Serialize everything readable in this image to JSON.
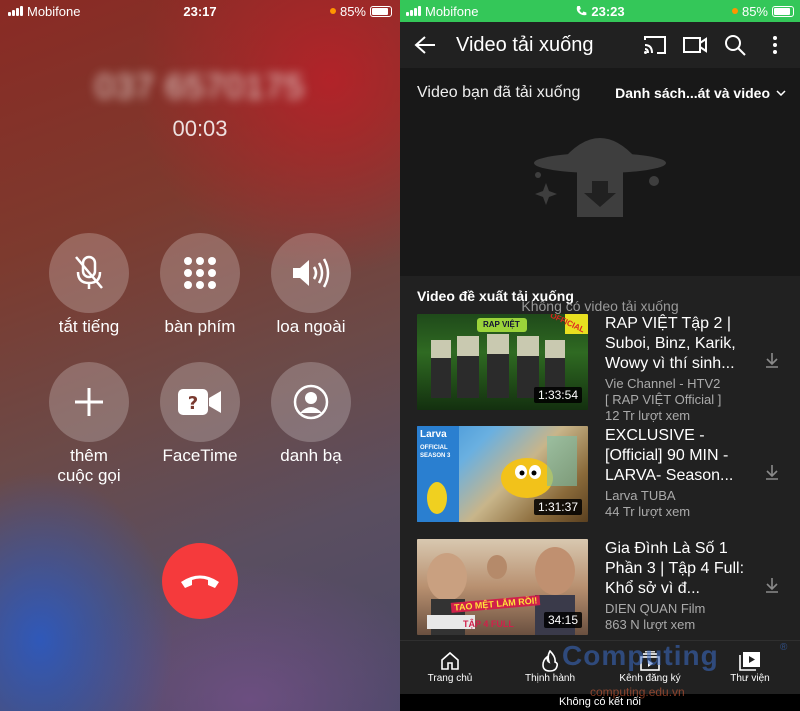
{
  "call_screen": {
    "status_bar": {
      "carrier": "Mobifone",
      "time": "23:17",
      "battery": "85%"
    },
    "caller_number": "037 6570175",
    "call_duration": "00:03",
    "controls": [
      {
        "label": "tắt tiếng",
        "icon": "mic-off-icon"
      },
      {
        "label": "bàn phím",
        "icon": "keypad-icon"
      },
      {
        "label": "loa ngoài",
        "icon": "speaker-icon"
      },
      {
        "label": "thêm\ncuộc gọi",
        "icon": "plus-icon"
      },
      {
        "label": "FaceTime",
        "icon": "facetime-icon"
      },
      {
        "label": "danh bạ",
        "icon": "contacts-icon"
      }
    ],
    "end_call_color": "#f53a3c"
  },
  "youtube": {
    "status_bar": {
      "carrier": "Mobifone",
      "time": "23:23",
      "battery": "85%",
      "bar_color": "#34c759"
    },
    "app_bar": {
      "title": "Video tải xuống"
    },
    "downloads": {
      "label": "Video bạn đã tải xuống",
      "sort": "Danh sách...át và video",
      "empty_text": "Không có video tải xuống"
    },
    "suggestions_title": "Video đề xuất tải xuống",
    "videos": [
      {
        "title": "RAP VIỆT Tập 2 | Suboi, Binz, Karik, Wowy vì thí sinh...",
        "channel": "Vie Channel - HTV2",
        "meta": "[ RAP VIỆT Official ]",
        "views": "12 Tr lượt xem",
        "duration": "1:33:54",
        "thumb_text": "RAP VIỆT",
        "thumb_badge": "OFFICIAL"
      },
      {
        "title": "EXCLUSIVE - [Official] 90 MIN - LARVA- Season...",
        "channel": "Larva TUBA",
        "meta": "44 Tr lượt xem",
        "views": "",
        "duration": "1:31:37",
        "thumb_text": "Larva",
        "thumb_badge": "OFFICIAL SEASON 3"
      },
      {
        "title": "Gia Đình Là Số 1 Phần 3 | Tập 4 Full: Khổ sở vì đ...",
        "channel": "DIEN QUAN Film",
        "meta": "863 N lượt xem",
        "views": "",
        "duration": "34:15",
        "thumb_text": "TAO MỆT LẮM RỒI!",
        "thumb_badge": "TẬP 4 FULL"
      }
    ],
    "bottom_nav": [
      {
        "label": "Trang chủ",
        "icon": "home-icon"
      },
      {
        "label": "Thịnh hành",
        "icon": "fire-icon"
      },
      {
        "label": "Kênh đăng ký",
        "icon": "subscriptions-icon"
      },
      {
        "label": "Thư viện",
        "icon": "library-icon"
      }
    ],
    "offline_text": "Không có kết nối"
  },
  "watermark": {
    "brand": "Computing",
    "site": "computing.edu.vn"
  }
}
